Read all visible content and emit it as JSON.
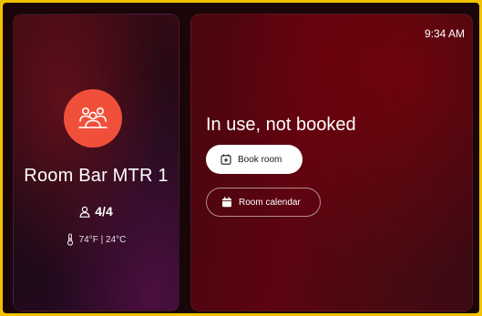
{
  "room": {
    "name": "Room Bar MTR 1",
    "capacity": "4/4",
    "temperature": "74°F | 24°C",
    "avatar_icon": "people-group-icon",
    "avatar_color": "#f0503a"
  },
  "status": {
    "time": "9:34 AM",
    "message": "In use, not booked"
  },
  "actions": {
    "book_room_label": "Book room",
    "book_room_icon": "calendar-plus-icon",
    "room_calendar_label": "Room calendar",
    "room_calendar_icon": "calendar-icon"
  },
  "colors": {
    "frame_border": "#f2c200",
    "accent": "#f0503a"
  }
}
